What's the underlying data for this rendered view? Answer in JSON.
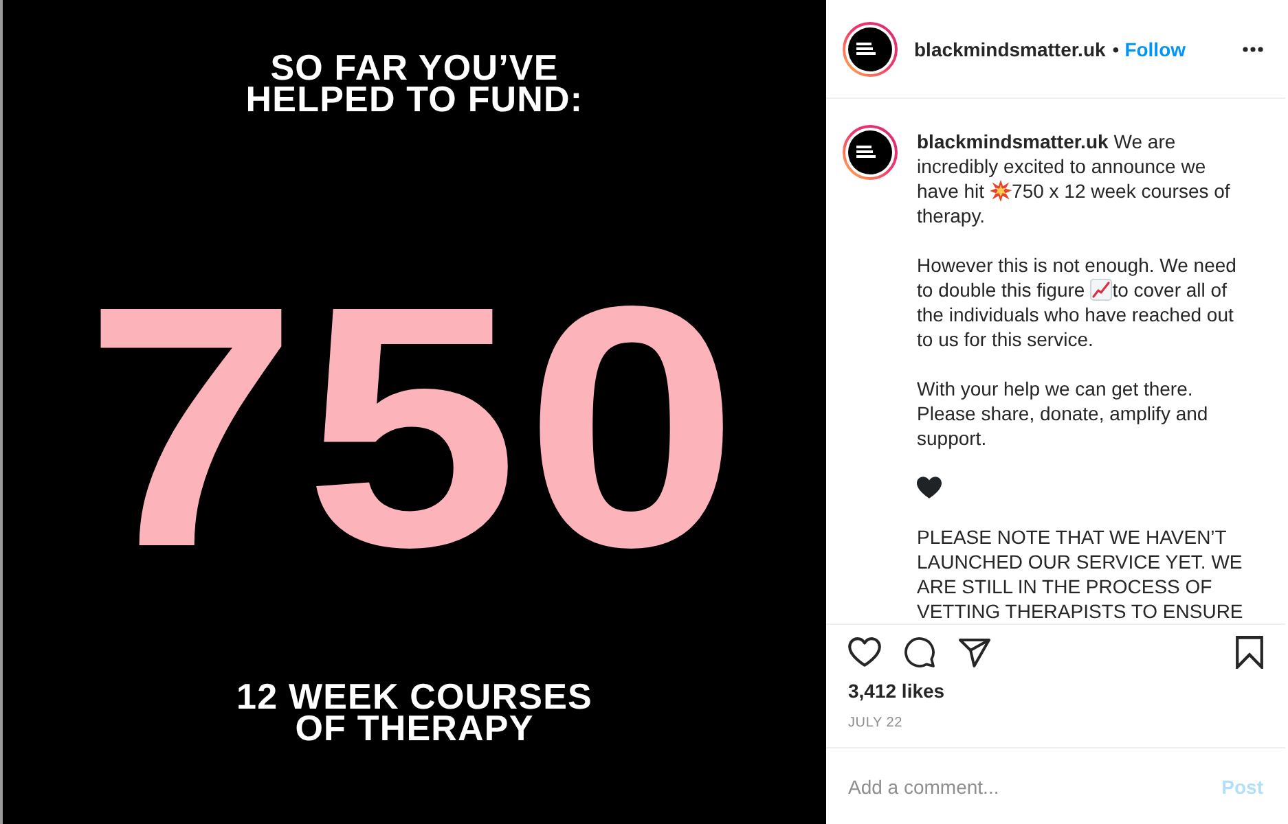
{
  "post_image": {
    "headline": "SO FAR YOU’VE\nHELPED TO FUND:",
    "figure": "750",
    "footer": "12 WEEK COURSES\nOF THERAPY"
  },
  "header": {
    "username": "blackmindsmatter.uk",
    "separator": "•",
    "follow_label": "Follow"
  },
  "caption": {
    "paragraphs": [
      {
        "lines": [
          [
            {
              "kind": "author",
              "text": "blackmindsmatter.uk"
            },
            {
              "kind": "text",
              "text": "We are"
            }
          ],
          [
            {
              "kind": "text",
              "text": "incredibly excited to announce we"
            }
          ],
          [
            {
              "kind": "text",
              "text": "have hit"
            },
            {
              "kind": "burst"
            },
            {
              "kind": "text",
              "text": "750 x 12 week courses of"
            }
          ],
          [
            {
              "kind": "text",
              "text": "therapy."
            }
          ]
        ]
      },
      {
        "lines": [
          [
            {
              "kind": "text",
              "text": "However this is not enough. We need"
            }
          ],
          [
            {
              "kind": "text",
              "text": "to double this figure"
            },
            {
              "kind": "chart"
            },
            {
              "kind": "text",
              "text": "to cover all of"
            }
          ],
          [
            {
              "kind": "text",
              "text": "the individuals who have reached out"
            }
          ],
          [
            {
              "kind": "text",
              "text": "to us for this service."
            }
          ]
        ]
      },
      {
        "lines": [
          [
            {
              "kind": "text",
              "text": "With your help we can get there."
            }
          ],
          [
            {
              "kind": "text",
              "text": "Please share, donate, amplify and"
            }
          ],
          [
            {
              "kind": "text",
              "text": "support."
            }
          ]
        ]
      },
      {
        "lines": [
          [
            {
              "kind": "heart"
            }
          ]
        ]
      },
      {
        "lines": [
          [
            {
              "kind": "text",
              "text": "PLEASE NOTE THAT WE HAVEN’T"
            }
          ],
          [
            {
              "kind": "text",
              "text": "LAUNCHED OUR SERVICE YET. WE"
            }
          ],
          [
            {
              "kind": "text",
              "text": "ARE STILL IN THE PROCESS OF"
            }
          ],
          [
            {
              "kind": "text",
              "text": "VETTING THERAPISTS TO ENSURE"
            }
          ]
        ]
      }
    ]
  },
  "actions": {
    "liked": false,
    "saved": false
  },
  "likes": "3,412 likes",
  "date": "JULY 22",
  "comment": {
    "placeholder": "Add a comment...",
    "post_button": {
      "label": "Post",
      "disabled": true
    }
  }
}
